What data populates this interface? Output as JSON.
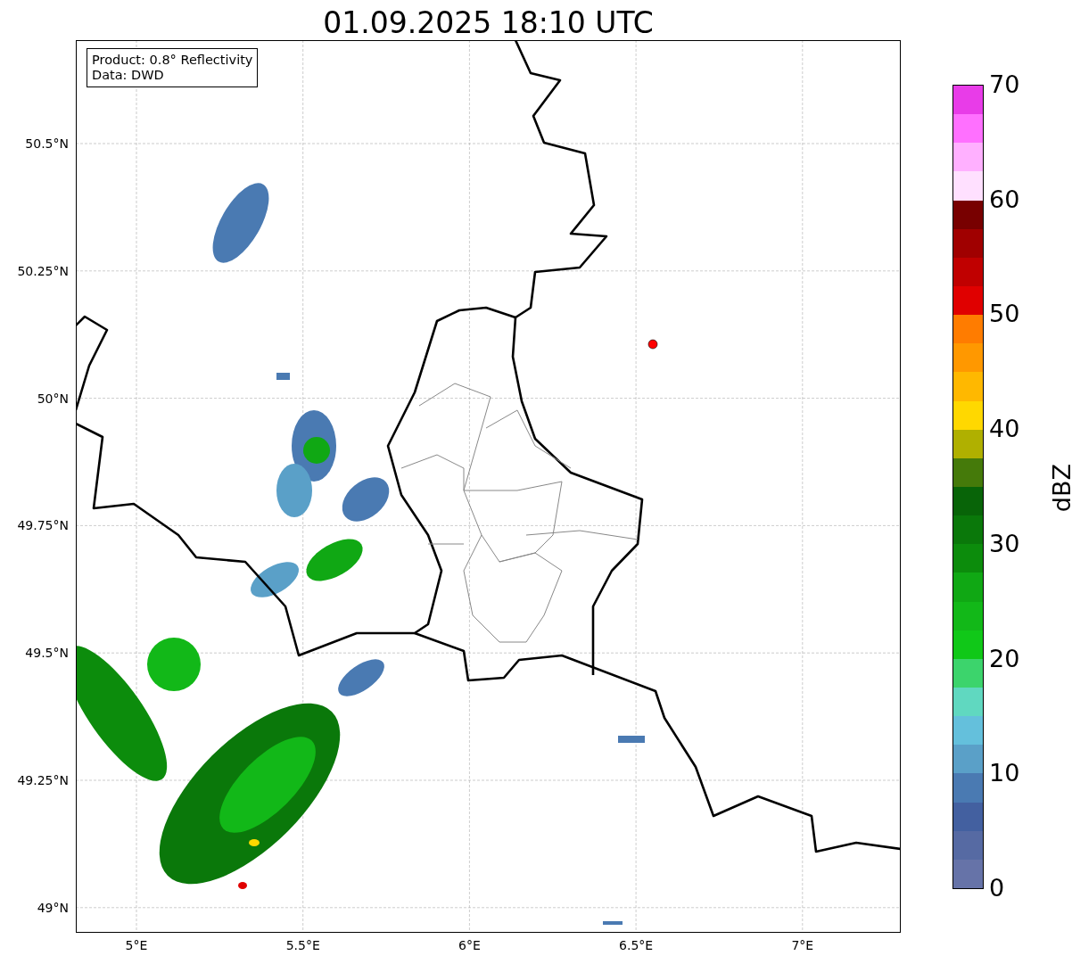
{
  "title": "01.09.2025 18:10 UTC",
  "legend": [
    "Product: 0.8° Reflectivity",
    "Data: DWD"
  ],
  "lat_ticks": [
    "50.5°N",
    "50.25°N",
    "50°N",
    "49.75°N",
    "49.5°N",
    "49.25°N",
    "49°N"
  ],
  "lon_ticks": [
    "5°E",
    "5.5°E",
    "6°E",
    "6.5°E",
    "7°E"
  ],
  "colorbar": {
    "label": "dBZ",
    "ticks": [
      "70",
      "60",
      "50",
      "40",
      "30",
      "20",
      "10",
      "0"
    ],
    "segments": [
      {
        "color": "#6673a8"
      },
      {
        "color": "#566aa3"
      },
      {
        "color": "#4360a0"
      },
      {
        "color": "#4a7ab2"
      },
      {
        "color": "#5aa0c8"
      },
      {
        "color": "#64c0dc"
      },
      {
        "color": "#60d8c0"
      },
      {
        "color": "#3cd46c"
      },
      {
        "color": "#10c818"
      },
      {
        "color": "#12b818"
      },
      {
        "color": "#10a814"
      },
      {
        "color": "#0c8c0c"
      },
      {
        "color": "#0a780a"
      },
      {
        "color": "#086408"
      },
      {
        "color": "#457a0a"
      },
      {
        "color": "#b0b000"
      },
      {
        "color": "#ffd800"
      },
      {
        "color": "#ffb800"
      },
      {
        "color": "#ff9800"
      },
      {
        "color": "#ff7c00"
      },
      {
        "color": "#e00000"
      },
      {
        "color": "#c00000"
      },
      {
        "color": "#a00000"
      },
      {
        "color": "#780000"
      },
      {
        "color": "#ffe0ff"
      },
      {
        "color": "#ffb0ff"
      },
      {
        "color": "#ff70ff"
      },
      {
        "color": "#e83ce8"
      }
    ]
  }
}
